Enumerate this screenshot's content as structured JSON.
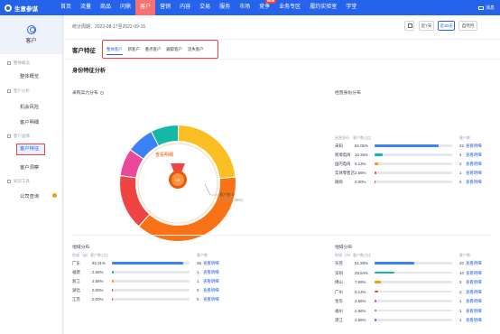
{
  "app": {
    "title": "生意参谋",
    "msg": "消息"
  },
  "nav": [
    "首页",
    "流量",
    "商品",
    "问鼎",
    "客户",
    "营销",
    "内容",
    "交易",
    "服务",
    "市场",
    "竞争",
    "业务专区",
    "履约实验室",
    "学堂"
  ],
  "nav_active": 4,
  "nav_badge": "NEW",
  "sidebar": {
    "title": "客户",
    "groups": [
      "整体概览",
      "客户分析",
      "客户画像",
      "知识工具"
    ],
    "items": [
      "整体概览",
      "机会风险",
      "客户明细",
      "客户特征",
      "客户洞察",
      "公司查询"
    ],
    "active": "客户特征"
  },
  "filter": {
    "period": "统计周期：2022-08-17至2022-09-15",
    "buttons": [
      "近7天",
      "近30天",
      "自然月"
    ],
    "active": "近30天"
  },
  "tabs": {
    "title": "客户特征",
    "items": [
      "整体客户",
      "新客户",
      "重点客户",
      "跟踪客户",
      "流失客户"
    ],
    "active": "整体客户"
  },
  "section_title": "身份特征分析",
  "purchase": {
    "title": "采购实力分布",
    "center_link": "查看明细",
    "count_label": "客户数 5",
    "count_pct": "(占比 23.08%)",
    "slices": [
      {
        "value": 23.08,
        "color": "#fbbf24"
      },
      {
        "value": 38.46,
        "color": "#f97316"
      },
      {
        "value": 15.38,
        "color": "#ef4444"
      },
      {
        "value": 7.69,
        "color": "#ec4899"
      },
      {
        "value": 7.69,
        "color": "#3b82f6"
      },
      {
        "value": 7.7,
        "color": "#14b8a6"
      }
    ]
  },
  "operate": {
    "title": "经营身份分布",
    "headers": [
      "经营身份",
      "客户数占比",
      "客户数"
    ],
    "rows": [
      {
        "name": "未知",
        "pct": "82.05%",
        "count": "32",
        "ratio": 0.8205,
        "color": "#3b82f6"
      },
      {
        "name": "跨境电商",
        "pct": "10.26%",
        "count": "4",
        "ratio": 0.1026,
        "color": "#14b8a6"
      },
      {
        "name": "国内电商",
        "pct": "5.13%",
        "count": "2",
        "ratio": 0.0513,
        "color": "#f59e0b"
      },
      {
        "name": "实体零售店",
        "pct": "2.56%",
        "count": "1",
        "ratio": 0.0256,
        "color": "#ef4444"
      },
      {
        "name": "微商",
        "pct": "0.00%",
        "count": "0",
        "ratio": 0,
        "color": "#ec4899"
      }
    ]
  },
  "province": {
    "title": "地域分布",
    "headers": [
      "地域（省）",
      "客户数占比",
      "客户数"
    ],
    "rows": [
      {
        "name": "广东",
        "pct": "92.31%",
        "count": "36",
        "ratio": 0.9231,
        "color": "#3b82f6"
      },
      {
        "name": "福建",
        "pct": "2.56%",
        "count": "1",
        "ratio": 0.0256,
        "color": "#14b8a6"
      },
      {
        "name": "浙江",
        "pct": "2.56%",
        "count": "1",
        "ratio": 0.0256,
        "color": "#f59e0b"
      },
      {
        "name": "湖北",
        "pct": "0.00%",
        "count": "0",
        "ratio": 0,
        "color": "#ef4444"
      },
      {
        "name": "江苏",
        "pct": "0.00%",
        "count": "0",
        "ratio": 0,
        "color": "#ec4899"
      }
    ]
  },
  "city": {
    "title": "地域分布",
    "headers": [
      "地域（市）",
      "客户数占比",
      "客户数"
    ],
    "rows": [
      {
        "name": "东莞",
        "pct": "51.28%",
        "count": "20",
        "ratio": 0.5128,
        "color": "#3b82f6"
      },
      {
        "name": "深圳",
        "pct": "25.64%",
        "count": "10",
        "ratio": 0.2564,
        "color": "#14b8a6"
      },
      {
        "name": "佛山",
        "pct": "7.69%",
        "count": "3",
        "ratio": 0.0769,
        "color": "#f59e0b"
      },
      {
        "name": "广州",
        "pct": "5.13%",
        "count": "2",
        "ratio": 0.0513,
        "color": "#ef4444"
      },
      {
        "name": "金华",
        "pct": "2.56%",
        "count": "1",
        "ratio": 0.0256,
        "color": "#ec4899"
      },
      {
        "name": "福州",
        "pct": "2.56%",
        "count": "1",
        "ratio": 0.0256,
        "color": "#8b5cf6"
      },
      {
        "name": "湛江",
        "pct": "2.56%",
        "count": "1",
        "ratio": 0.0256,
        "color": "#6366f1"
      }
    ]
  },
  "detail_link": "查看明细"
}
